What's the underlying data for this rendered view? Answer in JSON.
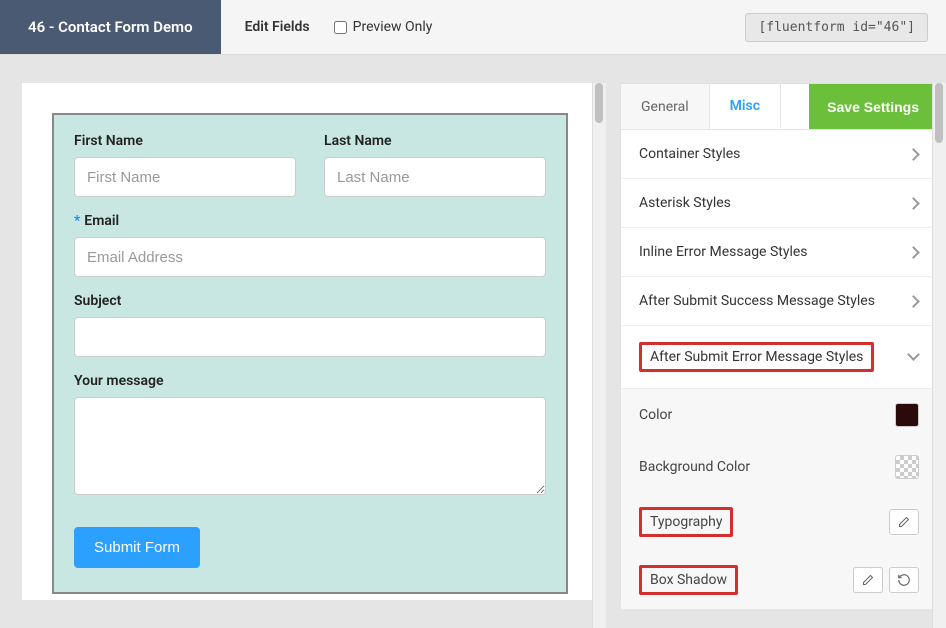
{
  "topbar": {
    "title": "46 - Contact Form Demo",
    "edit_fields": "Edit Fields",
    "preview_only": "Preview Only",
    "shortcode": "[fluentform id=\"46\"]"
  },
  "form": {
    "first_name_label": "First Name",
    "first_name_placeholder": "First Name",
    "last_name_label": "Last Name",
    "last_name_placeholder": "Last Name",
    "email_label": "Email",
    "email_placeholder": "Email Address",
    "subject_label": "Subject",
    "message_label": "Your message",
    "submit_label": "Submit Form"
  },
  "settings": {
    "tabs": {
      "general": "General",
      "misc": "Misc"
    },
    "save_button": "Save Settings",
    "sections": {
      "container": "Container Styles",
      "asterisk": "Asterisk Styles",
      "inline_error": "Inline Error Message Styles",
      "success_msg": "After Submit Success Message Styles",
      "error_msg": "After Submit Error Message Styles"
    },
    "props": {
      "color": "Color",
      "bg_color": "Background Color",
      "typography": "Typography",
      "box_shadow": "Box Shadow"
    }
  }
}
